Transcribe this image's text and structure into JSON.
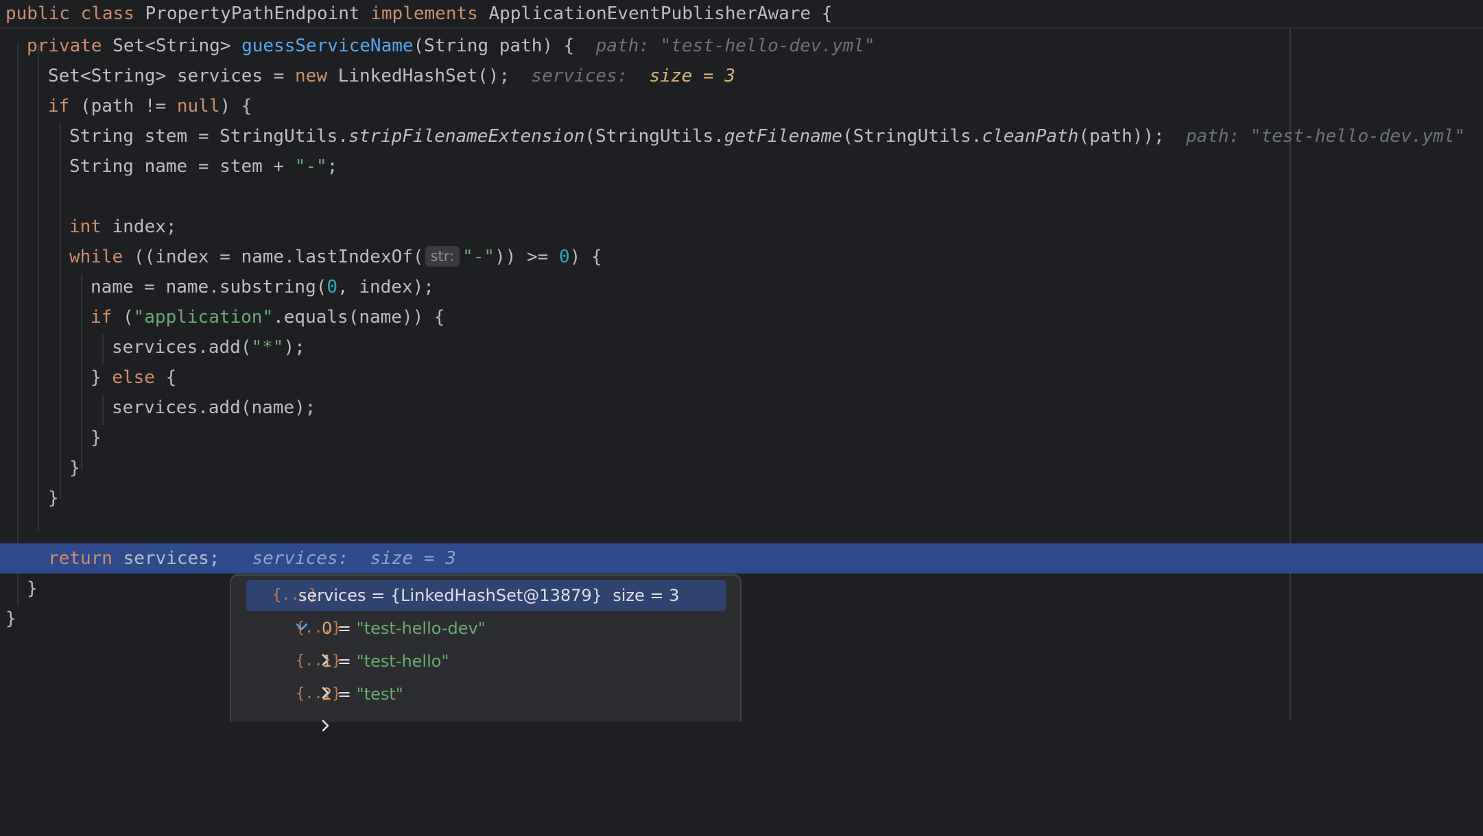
{
  "editor": {
    "class_decl": {
      "modifier": "public",
      "keyword": "class",
      "name": "PropertyPathEndpoint",
      "implements_kw": "implements",
      "interface": "ApplicationEventPublisherAware",
      "brace": "{"
    },
    "method_decl": {
      "modifier": "private",
      "type": "Set<String>",
      "name": "guessServiceName",
      "params": "(String path) {",
      "hint": "path: \"test-hello-dev.yml\""
    },
    "line_services_init": {
      "pre": "Set<String> services = ",
      "new_kw": "new",
      "post": " LinkedHashSet();",
      "hint_label": "services:",
      "hint_value": "size = 3"
    },
    "line_if_path": {
      "if_kw": "if",
      "mid": " (path != ",
      "null_kw": "null",
      "post": ") {"
    },
    "line_stem": {
      "pre": "String stem = StringUtils.",
      "m1": "stripFilenameExtension",
      "mid1": "(StringUtils.",
      "m2": "getFilename",
      "mid2": "(StringUtils.",
      "m3": "cleanPath",
      "post": "(path));",
      "hint": "path: \"test-hello-dev.yml\""
    },
    "line_name": {
      "pre": "String name = stem + ",
      "str": "\"-\"",
      "post": ";"
    },
    "line_index": {
      "int_kw": "int",
      "post": " index;"
    },
    "line_while": {
      "while_kw": "while",
      "pre": " ((index = name.lastIndexOf(",
      "param_hint": "str:",
      "str": "\"-\"",
      "mid": ")) >= ",
      "num": "0",
      "post": ") {"
    },
    "line_substring": {
      "pre": "name = name.substring(",
      "num": "0",
      "post": ", index);"
    },
    "line_if_app": {
      "if_kw": "if",
      "pre": " (",
      "str": "\"application\"",
      "post": ".equals(name)) {"
    },
    "line_add_star": {
      "pre": "services.add(",
      "str": "\"*\"",
      "post": ");"
    },
    "line_else": {
      "pre": "} ",
      "else_kw": "else",
      "post": " {"
    },
    "line_add_name": "services.add(name);",
    "close_brace": "}",
    "line_return": {
      "return_kw": "return",
      "post": " services;",
      "hint_label": "services:",
      "hint_value": "size = 3"
    }
  },
  "debug_popup": {
    "root": {
      "icon": "{...}",
      "name": "services",
      "value": "= {LinkedHashSet@13879}",
      "size": "size = 3",
      "expanded": true
    },
    "children": [
      {
        "icon": "{...}",
        "index": "0",
        "eq": " = ",
        "value": "\"test-hello-dev\""
      },
      {
        "icon": "{...}",
        "index": "1",
        "eq": " = ",
        "value": "\"test-hello\""
      },
      {
        "icon": "{...}",
        "index": "2",
        "eq": " = ",
        "value": "\"test\""
      }
    ],
    "icons": {
      "expand": "chevron-down-icon",
      "collapse": "chevron-right-icon",
      "object": "object-icon"
    },
    "colors": {
      "selection": "#2e436e",
      "string": "#6aab73",
      "exec_line": "#2e4a8c"
    }
  }
}
